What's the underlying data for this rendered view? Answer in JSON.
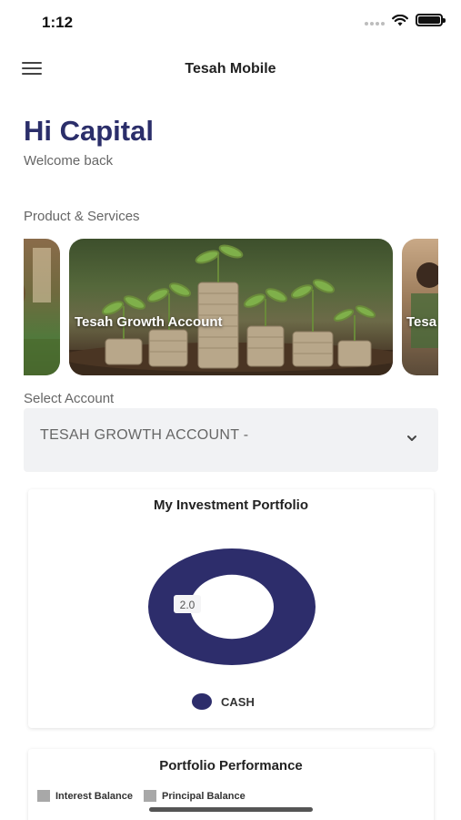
{
  "status_bar": {
    "time": "1:12"
  },
  "app_bar": {
    "title": "Tesah Mobile",
    "menu_icon": "hamburger-menu-icon"
  },
  "greeting": {
    "title": "Hi Capital",
    "subtitle": "Welcome back"
  },
  "products": {
    "section_label": "Product & Services",
    "cards": [
      {
        "label": ""
      },
      {
        "label": "Tesah Growth Account"
      },
      {
        "label": "Tesa"
      }
    ]
  },
  "account_select": {
    "label": "Select Account",
    "value": "TESAH GROWTH ACCOUNT -",
    "icon": "chevron-down-icon"
  },
  "portfolio": {
    "title": "My Investment Portfolio",
    "colors": {
      "cash": "#2d2d6b"
    }
  },
  "chart_data": {
    "type": "pie",
    "title": "My Investment Portfolio",
    "labels": [
      "CASH"
    ],
    "values": [
      2.0
    ],
    "data_labels": [
      "2.0"
    ],
    "colors": [
      "#2d2d6b"
    ],
    "legend": "bottom"
  },
  "performance": {
    "title": "Portfolio Performance",
    "legend": [
      "Interest Balance",
      "Principal Balance"
    ],
    "legend_color": "#a8a8a8"
  }
}
